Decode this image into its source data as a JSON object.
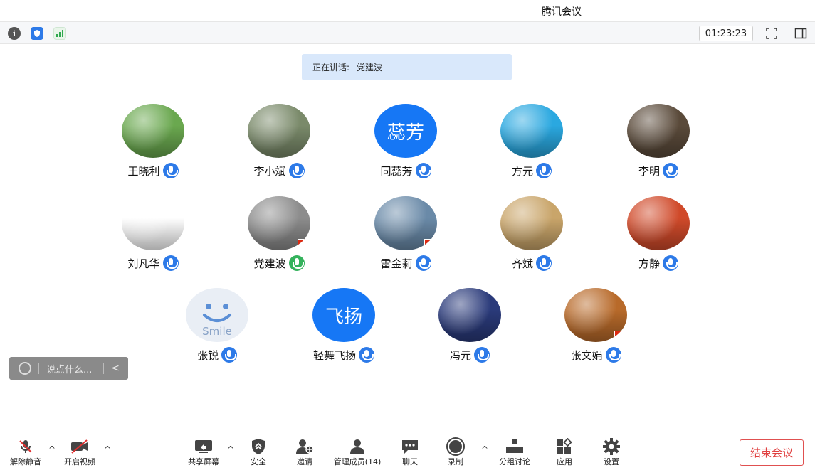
{
  "window": {
    "title": "腾讯会议"
  },
  "top_toolbar": {
    "timer": "01:23:23"
  },
  "speaking": {
    "label": "正在讲话:",
    "name": "党建波"
  },
  "participants": [
    {
      "name": "王晓利",
      "avatar_text": "",
      "avatar_color": "#6aa84f"
    },
    {
      "name": "李小斌",
      "avatar_text": "",
      "avatar_color": "#7a8a6a"
    },
    {
      "name": "同蕊芳",
      "avatar_text": "蕊芳",
      "avatar_color": "#1677f5"
    },
    {
      "name": "方元",
      "avatar_text": "",
      "avatar_color": "#2aa8e0"
    },
    {
      "name": "李明",
      "avatar_text": "",
      "avatar_color": "#5a4a3a"
    },
    {
      "name": "刘凡华",
      "avatar_text": "",
      "avatar_color": "#ffffff"
    },
    {
      "name": "党建波",
      "avatar_text": "",
      "avatar_color": "#8c8c8c"
    },
    {
      "name": "雷金莉",
      "avatar_text": "",
      "avatar_color": "#6a8aa8"
    },
    {
      "name": "齐斌",
      "avatar_text": "",
      "avatar_color": "#c9a56a"
    },
    {
      "name": "方静",
      "avatar_text": "",
      "avatar_color": "#d04a2a"
    },
    {
      "name": "张锐",
      "avatar_text": "",
      "avatar_color": "#e9eef5"
    },
    {
      "name": "轻舞飞扬",
      "avatar_text": "飞扬",
      "avatar_color": "#1677f5"
    },
    {
      "name": "冯元",
      "avatar_text": "",
      "avatar_color": "#2a3a7a"
    },
    {
      "name": "张文娟",
      "avatar_text": "",
      "avatar_color": "#b86a2a"
    }
  ],
  "chat": {
    "placeholder": "说点什么..."
  },
  "bottom_toolbar": {
    "unmute": "解除静音",
    "start_video": "开启视频",
    "share_screen": "共享屏幕",
    "security": "安全",
    "invite": "邀请",
    "manage_members": "管理成员(14)",
    "chat": "聊天",
    "record": "录制",
    "breakout": "分组讨论",
    "apps": "应用",
    "settings": "设置",
    "end_meeting": "结束会议"
  }
}
